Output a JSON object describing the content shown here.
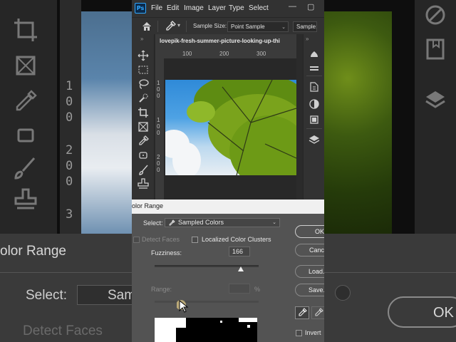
{
  "app": {
    "logo": "Ps",
    "menu": [
      "File",
      "Edit",
      "Image",
      "Layer",
      "Type",
      "Select"
    ],
    "window_controls": {
      "minimize": "—",
      "maximize": "▢"
    }
  },
  "options_bar": {
    "sample_size_label": "Sample Size:",
    "sample_size_value": "Point Sample",
    "sample_button_label": "Sample:"
  },
  "document": {
    "tab_title": "lovepik-fresh-summer-picture-looking-up-thi",
    "ruler_h": [
      "100",
      "200",
      "300"
    ],
    "ruler_v": [
      [
        "1",
        "0",
        "0"
      ],
      [
        "1",
        "0",
        "0"
      ],
      [
        "2",
        "0",
        "0"
      ]
    ]
  },
  "dialog": {
    "title": "olor Range",
    "select_label": "Select:",
    "select_value": "Sampled Colors",
    "detect_faces_label": "Detect Faces",
    "localized_clusters_label": "Localized Color Clusters",
    "fuzziness_label": "Fuzziness:",
    "fuzziness_value": "166",
    "fuzziness_max": 200,
    "range_label": "Range:",
    "range_unit": "%",
    "ok_label": "OK",
    "cancel_label": "Cancel",
    "load_label": "Load...",
    "save_label": "Save...",
    "invert_label": "Invert"
  },
  "background_zoom": {
    "dialog_title": "olor Range",
    "select_label": "Select:",
    "select_value": "Sampl",
    "detect_faces_label": "Detect Faces",
    "ok_label": "OK",
    "ruler_v": [
      "0",
      "1",
      "0",
      "0",
      "2",
      "0",
      "0",
      "3"
    ]
  },
  "colors": {
    "ps_blue": "#31a8ff",
    "panel": "#323232",
    "dialog": "#535353"
  },
  "icons": [
    "home-icon",
    "eyedropper-icon",
    "move-icon",
    "marquee-icon",
    "lasso-icon",
    "quick-select-icon",
    "crop-icon",
    "frame-icon",
    "brush-icon",
    "stamp-icon",
    "healing-icon",
    "libraries-icon",
    "adjustments-icon",
    "layers-icon",
    "cursor-icon"
  ]
}
